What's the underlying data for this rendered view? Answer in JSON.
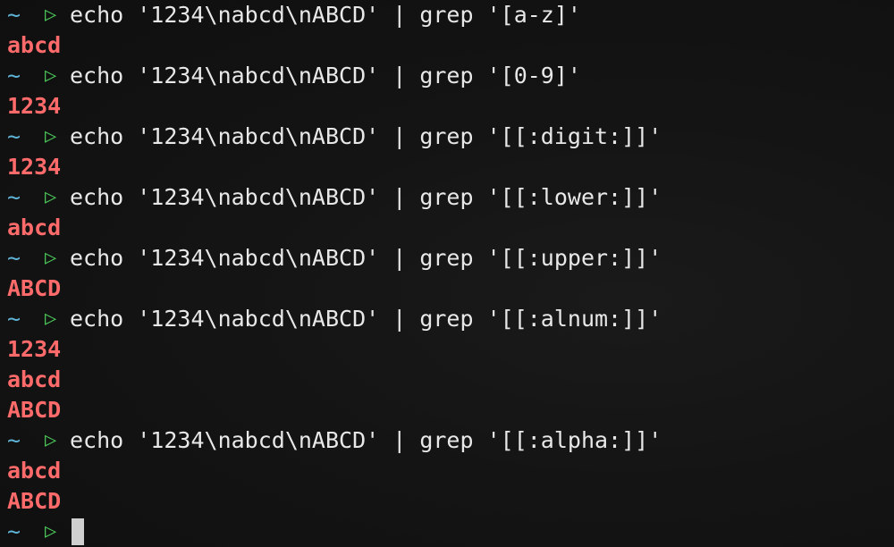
{
  "prompt": {
    "tilde": "~",
    "arrow": "▷"
  },
  "blocks": [
    {
      "command": "echo '1234\\nabcd\\nABCD' | grep '[a-z]'",
      "output": [
        "abcd"
      ]
    },
    {
      "command": "echo '1234\\nabcd\\nABCD' | grep '[0-9]'",
      "output": [
        "1234"
      ]
    },
    {
      "command": "echo '1234\\nabcd\\nABCD' | grep '[[:digit:]]'",
      "output": [
        "1234"
      ]
    },
    {
      "command": "echo '1234\\nabcd\\nABCD' | grep '[[:lower:]]'",
      "output": [
        "abcd"
      ]
    },
    {
      "command": "echo '1234\\nabcd\\nABCD' | grep '[[:upper:]]'",
      "output": [
        "ABCD"
      ]
    },
    {
      "command": "echo '1234\\nabcd\\nABCD' | grep '[[:alnum:]]'",
      "output": [
        "1234",
        "abcd",
        "ABCD"
      ]
    },
    {
      "command": "echo '1234\\nabcd\\nABCD' | grep '[[:alpha:]]'",
      "output": [
        "abcd",
        "ABCD"
      ]
    }
  ],
  "colors": {
    "tilde": "#5fb3d6",
    "arrow": "#4cc95a",
    "command_text": "#e8e8e8",
    "match_output": "#ff6b6b",
    "background": "#121212",
    "cursor": "#cfcfcf"
  }
}
